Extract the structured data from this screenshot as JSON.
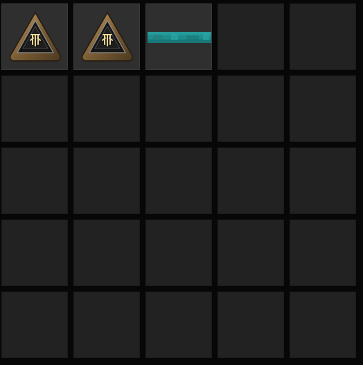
{
  "inventory": {
    "rows": 5,
    "columns": 5,
    "slots": [
      {
        "item": "relic-triangle-icon",
        "filled": true
      },
      {
        "item": "relic-triangle-icon",
        "filled": true
      },
      {
        "item": "teal-dye-bar-icon",
        "filled": true
      },
      {
        "item": null,
        "filled": false
      },
      {
        "item": null,
        "filled": false
      },
      {
        "item": null,
        "filled": false
      },
      {
        "item": null,
        "filled": false
      },
      {
        "item": null,
        "filled": false
      },
      {
        "item": null,
        "filled": false
      },
      {
        "item": null,
        "filled": false
      },
      {
        "item": null,
        "filled": false
      },
      {
        "item": null,
        "filled": false
      },
      {
        "item": null,
        "filled": false
      },
      {
        "item": null,
        "filled": false
      },
      {
        "item": null,
        "filled": false
      },
      {
        "item": null,
        "filled": false
      },
      {
        "item": null,
        "filled": false
      },
      {
        "item": null,
        "filled": false
      },
      {
        "item": null,
        "filled": false
      },
      {
        "item": null,
        "filled": false
      },
      {
        "item": null,
        "filled": false
      },
      {
        "item": null,
        "filled": false
      },
      {
        "item": null,
        "filled": false
      },
      {
        "item": null,
        "filled": false
      },
      {
        "item": null,
        "filled": false
      }
    ]
  },
  "colors": {
    "background": "#070707",
    "empty_slot": "#222222",
    "filled_slot": "#2f2f2f",
    "relic_bronze": "#8a6a3c",
    "relic_dark": "#141414",
    "relic_gold_glyph": "#e6cf8c",
    "dye_teal": "#1e8d8d"
  }
}
